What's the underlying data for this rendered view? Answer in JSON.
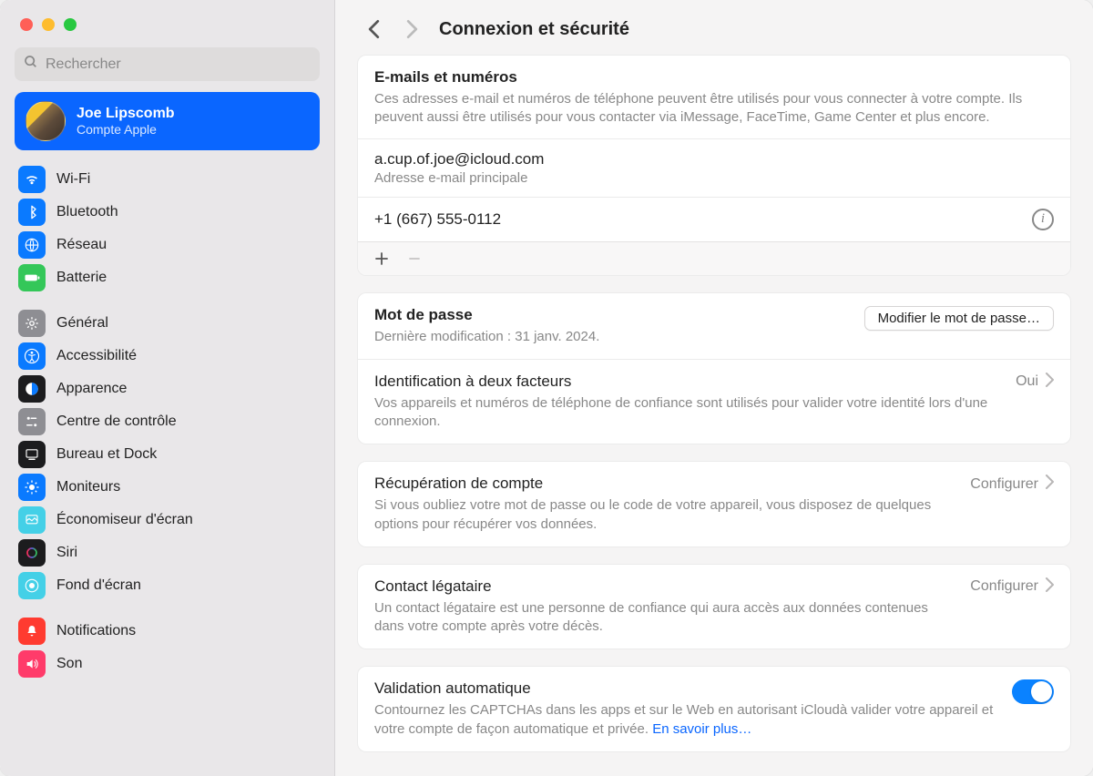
{
  "search": {
    "placeholder": "Rechercher"
  },
  "account": {
    "name": "Joe Lipscomb",
    "sub": "Compte Apple"
  },
  "sidebar": {
    "group1": [
      {
        "label": "Wi-Fi",
        "color": "#0a7aff"
      },
      {
        "label": "Bluetooth",
        "color": "#0a7aff"
      },
      {
        "label": "Réseau",
        "color": "#0a7aff"
      },
      {
        "label": "Batterie",
        "color": "#34c759"
      }
    ],
    "group2": [
      {
        "label": "Général",
        "color": "#8e8e93"
      },
      {
        "label": "Accessibilité",
        "color": "#0a7aff"
      },
      {
        "label": "Apparence",
        "color": "#1c1c1e"
      },
      {
        "label": "Centre de contrôle",
        "color": "#8e8e93"
      },
      {
        "label": "Bureau et Dock",
        "color": "#1c1c1e"
      },
      {
        "label": "Moniteurs",
        "color": "#0a7aff"
      },
      {
        "label": "Économiseur d'écran",
        "color": "#44d0e7"
      },
      {
        "label": "Siri",
        "color": "#1c1c1e"
      },
      {
        "label": "Fond d'écran",
        "color": "#44d0e7"
      }
    ],
    "group3": [
      {
        "label": "Notifications",
        "color": "#ff3b30"
      },
      {
        "label": "Son",
        "color": "#ff3b6a"
      }
    ]
  },
  "header": {
    "title": "Connexion et sécurité"
  },
  "emails": {
    "title": "E-mails et numéros",
    "desc": "Ces adresses e-mail et numéros de téléphone peuvent être utilisés pour vous connecter à votre compte. Ils peuvent aussi être utilisés pour vous contacter via iMessage, FaceTime, Game Center et plus encore.",
    "items": [
      {
        "primary": "a.cup.of.joe@icloud.com",
        "secondary": "Adresse e-mail principale"
      },
      {
        "primary": "+1 (667) 555-0112"
      }
    ]
  },
  "password": {
    "title": "Mot de passe",
    "desc": "Dernière modification : 31 janv. 2024.",
    "button": "Modifier le mot de passe…"
  },
  "twofa": {
    "title": "Identification à deux facteurs",
    "desc": "Vos appareils et numéros de téléphone de confiance sont utilisés pour valider votre identité lors d'une connexion.",
    "status": "Oui"
  },
  "recovery": {
    "title": "Récupération de compte",
    "desc": "Si vous oubliez votre mot de passe ou le code de votre appareil, vous disposez de quelques options pour récupérer vos données.",
    "action": "Configurer"
  },
  "legacy": {
    "title": "Contact légataire",
    "desc": "Un contact légataire est une personne de confiance qui aura accès aux données contenues dans votre compte après votre décès.",
    "action": "Configurer"
  },
  "autovalidate": {
    "title": "Validation automatique",
    "desc": "Contournez les CAPTCHAs dans les apps et sur le Web en autorisant iCloudà valider votre appareil et votre compte de façon automatique et privée. ",
    "link": "En savoir plus…"
  }
}
